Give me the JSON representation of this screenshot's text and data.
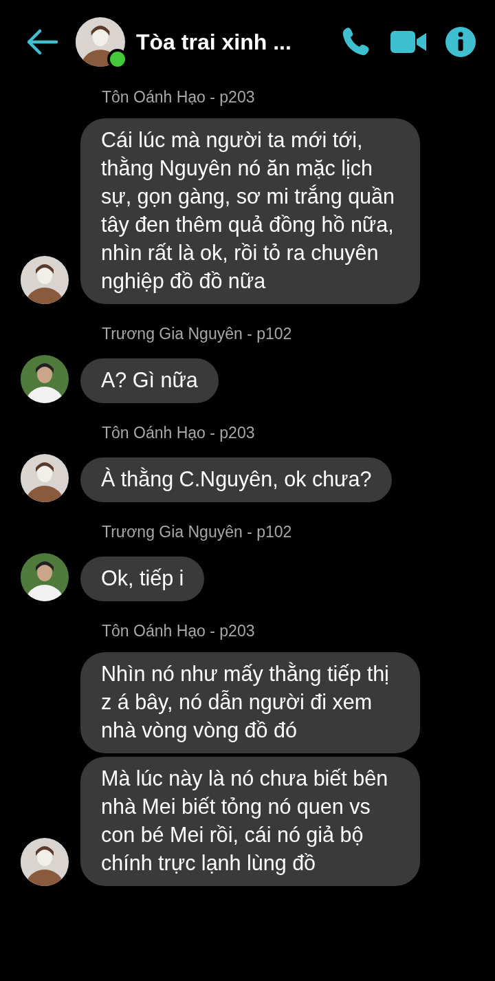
{
  "header": {
    "title": "Tòa trai xinh ...",
    "online": true
  },
  "groups": [
    {
      "sender": "Tôn Oánh Hạo - p203",
      "messages": [
        "Cái lúc mà người ta mới tới, thằng Nguyên nó ăn mặc lịch sự, gọn gàng, sơ mi trắng quần tây đen thêm quả đồng hồ nữa, nhìn rất là ok, rồi tỏ ra chuyên nghiệp đồ đồ nữa"
      ]
    },
    {
      "sender": "Trương Gia Nguyên - p102",
      "messages": [
        "A? Gì nữa"
      ]
    },
    {
      "sender": "Tôn Oánh Hạo - p203",
      "messages": [
        "À thằng C.Nguyên, ok chưa?"
      ]
    },
    {
      "sender": "Trương Gia Nguyên - p102",
      "messages": [
        "Ok, tiếp i"
      ]
    },
    {
      "sender": "Tôn Oánh Hạo - p203",
      "messages": [
        "Nhìn nó như mấy thằng tiếp thị z á bây, nó dẫn người đi xem nhà vòng vòng đồ đó",
        "Mà lúc này là nó chưa biết bên nhà Mei biết tỏng nó quen vs con bé Mei rồi, cái nó giả bộ chính trực lạnh lùng đồ"
      ]
    }
  ]
}
